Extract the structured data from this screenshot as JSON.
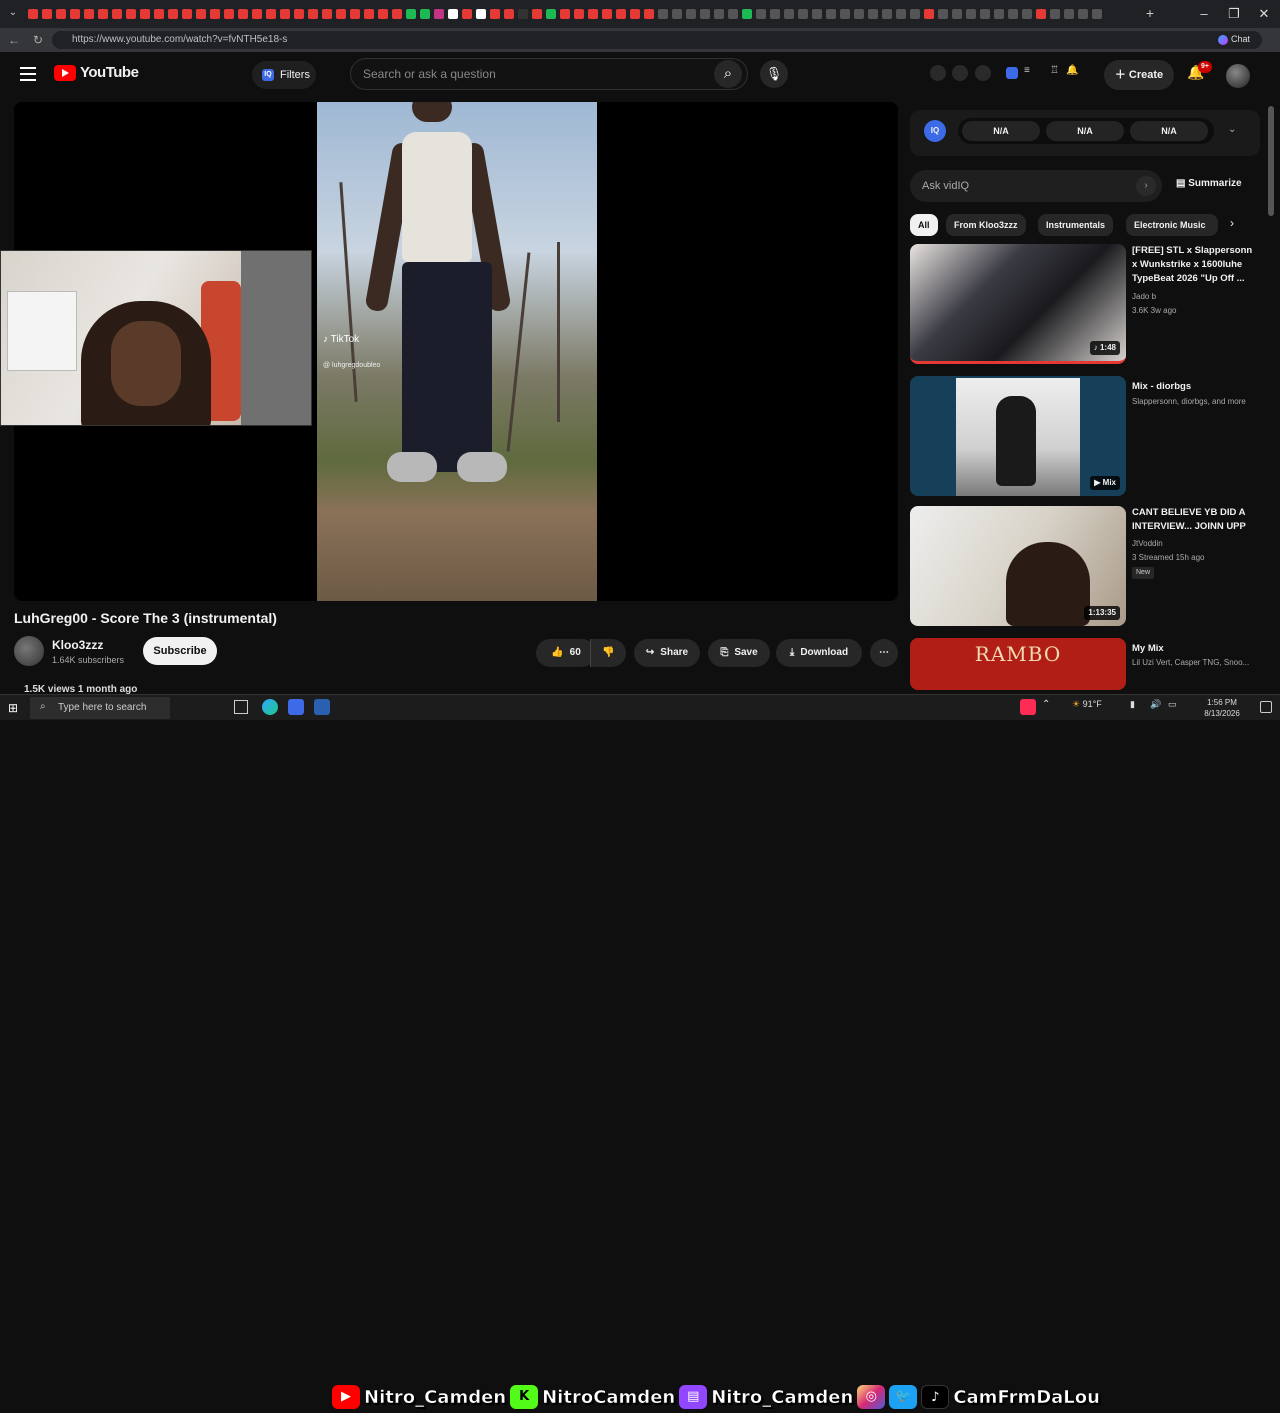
{
  "browser": {
    "url": "https://www.youtube.com/watch?v=fvNTH5e18-s",
    "chat_label": "Chat"
  },
  "header": {
    "logo_text": "YouTube",
    "filters_label": "Filters",
    "filters_badge": "IQ",
    "search_placeholder": "Search or ask a question",
    "create_label": "Create",
    "notif_count": "9+"
  },
  "video": {
    "title": "LuhGreg00 - Score The 3 (instrumental)",
    "tiktok_logo": "TikTok",
    "tiktok_handle": "@ luhgregdoubleo",
    "channel_name": "Kloo3zzz",
    "subscribers": "1.64K subscribers",
    "subscribe_label": "Subscribe",
    "likes": "60",
    "share_label": "Share",
    "save_label": "Save",
    "download_label": "Download",
    "views_line": "1.5K views  1 month ago"
  },
  "vidiq": {
    "logo": "IQ",
    "values": [
      "N/A",
      "N/A",
      "N/A"
    ],
    "ask_placeholder": "Ask vidIQ",
    "summarize_label": "Summarize"
  },
  "chips": [
    "All",
    "From Kloo3zzz",
    "Instrumentals",
    "Electronic Music"
  ],
  "recommendations": [
    {
      "title": "[FREE] STL x Slappersonn x Wunkstrike x 1600luhe TypeBeat 2026 \"Up Off ...",
      "channel": "Jado b",
      "meta": "3.6K  3w ago",
      "duration": "1:48",
      "badge": ""
    },
    {
      "title": "Mix - diorbgs",
      "channel": "Slappersonn, diorbgs, and more",
      "meta": "",
      "duration": "Mix",
      "badge": ""
    },
    {
      "title": "CANT BELIEVE YB DID A INTERVIEW... JOINN UPP",
      "channel": "JtVoddin",
      "meta": "3  Streamed 15h ago",
      "duration": "1:13:35",
      "badge": "New"
    },
    {
      "title": "My Mix",
      "channel": "Lil Uzi Vert, Casper TNG, Snoo...",
      "meta": "",
      "duration": "",
      "badge": "",
      "thumb_text": "RAMBO"
    }
  ],
  "taskbar": {
    "search_placeholder": "Type here to search",
    "overlay": [
      "Nitro_Camden",
      "NitroCamden",
      "Nitro_Camden",
      "CamFrmDaLou"
    ],
    "weather": "91°F",
    "time": "1:56 PM",
    "date": "8/13/2026"
  }
}
